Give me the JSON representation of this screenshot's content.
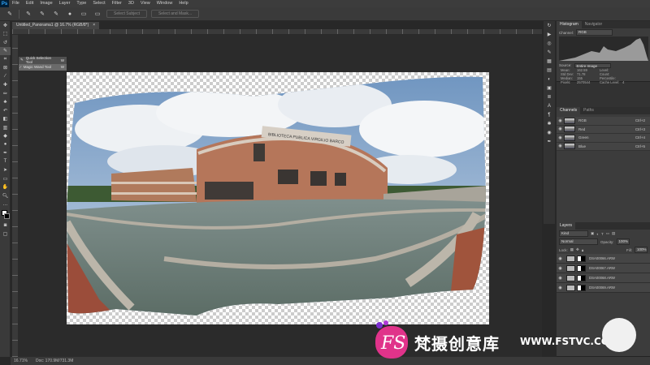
{
  "app": {
    "logo": "Ps"
  },
  "menu": [
    "File",
    "Edit",
    "Image",
    "Layer",
    "Type",
    "Select",
    "Filter",
    "3D",
    "View",
    "Window",
    "Help"
  ],
  "options": {
    "select_subject": "Select Subject",
    "select_and_mask": "Select and Mask..."
  },
  "document": {
    "tab_title": "Untitled_Panorama1 @ 16.7% (RGB/8*)",
    "tab_close": "×"
  },
  "flyout": [
    {
      "label": "Quick Selection Tool",
      "key": "W"
    },
    {
      "label": "Magic Wand Tool",
      "key": "W"
    }
  ],
  "status": {
    "zoom": "16.71%",
    "doc": "Doc: 170.9M/731.3M"
  },
  "histogram": {
    "tabs": [
      "Histogram",
      "Navigator"
    ],
    "channel_label": "Channel:",
    "channel_value": "RGB",
    "source_label": "Source:",
    "source_value": "Entire Image",
    "stats": [
      [
        "Mean:",
        "162.59",
        "Level:",
        ""
      ],
      [
        "Std Dev:",
        "71.78",
        "Count:",
        ""
      ],
      [
        "Median:",
        "155",
        "Percentile:",
        ""
      ],
      [
        "Pixels:",
        "2570544",
        "Cache Level:",
        "4"
      ]
    ]
  },
  "channels": {
    "tabs": [
      "Channels",
      "Paths"
    ],
    "rows": [
      {
        "name": "RGB",
        "key": "Ctrl+2"
      },
      {
        "name": "Red",
        "key": "Ctrl+3"
      },
      {
        "name": "Green",
        "key": "Ctrl+4"
      },
      {
        "name": "Blue",
        "key": "Ctrl+5"
      }
    ]
  },
  "layers": {
    "tab": "Layers",
    "kind": "Kind",
    "blend": "Normal",
    "opacity_label": "Opacity:",
    "opacity": "100%",
    "lock_label": "Lock:",
    "fill_label": "Fill:",
    "fill": "100%",
    "rows": [
      "DSA00066.ARW",
      "DSA00067.ARW",
      "DSA00068.ARW",
      "DSA00069.ARW"
    ]
  },
  "photo": {
    "building_sign": "BIBLIOTECA PUBLICA VIRGILIO BARCO"
  },
  "watermark": {
    "logo": "FS",
    "title": "梵摄创意库",
    "url": "WWW.FSTVC.CC"
  },
  "colors": {
    "accent": "#31a8ff",
    "watermark_pink": "#e0338a",
    "watermark_purple": "#7b2fd0"
  }
}
